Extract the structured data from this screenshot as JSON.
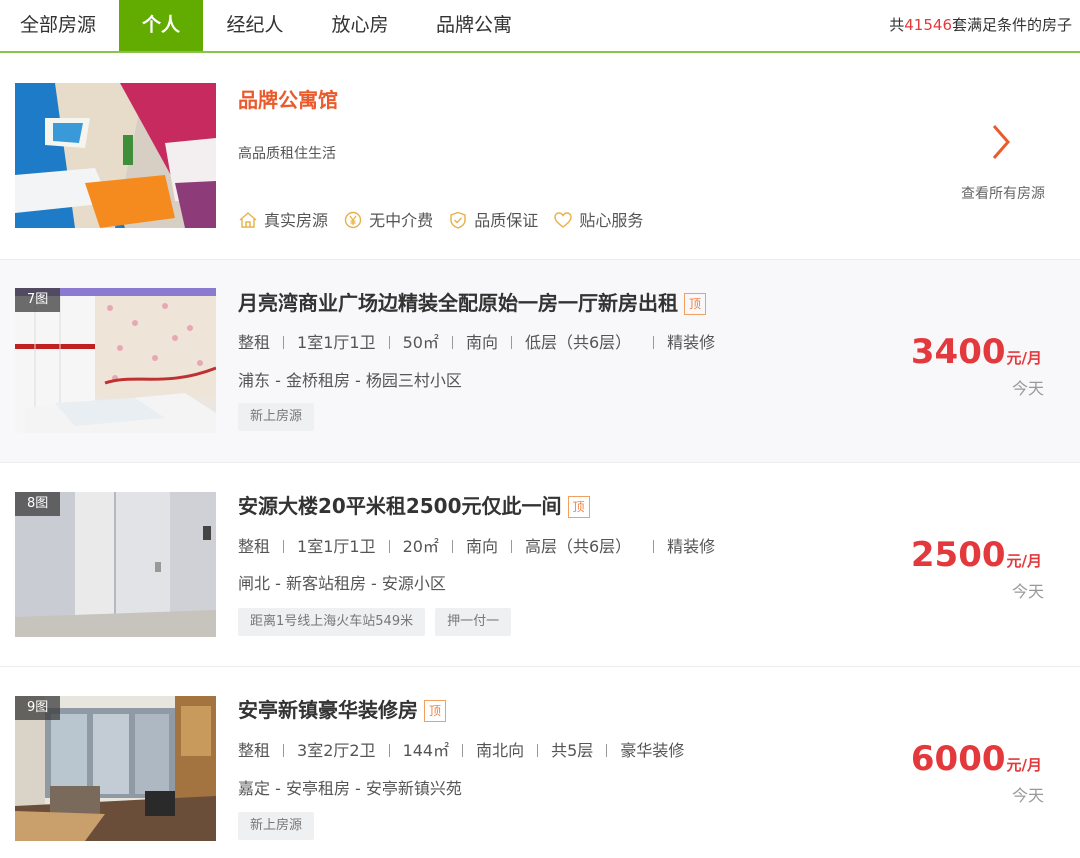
{
  "tabs": [
    {
      "label": "全部房源",
      "active": false
    },
    {
      "label": "个人",
      "active": true
    },
    {
      "label": "经纪人",
      "active": false
    },
    {
      "label": "放心房",
      "active": false
    },
    {
      "label": "品牌公寓",
      "active": false
    }
  ],
  "summary": {
    "prefix": "共",
    "count": "41546",
    "suffix": "套满足条件的房子"
  },
  "brand": {
    "title": "品牌公寓馆",
    "subtitle": "高品质租住生活",
    "features": [
      {
        "icon": "house-icon",
        "label": "真实房源"
      },
      {
        "icon": "yen-icon",
        "label": "无中介费"
      },
      {
        "icon": "shield-check-icon",
        "label": "品质保证"
      },
      {
        "icon": "heart-icon",
        "label": "贴心服务"
      }
    ],
    "view_all": "查看所有房源"
  },
  "listings": [
    {
      "photo_count": "7图",
      "title": "月亮湾商业广场边精装全配原始一房一厅新房出租",
      "top_tag": "顶",
      "info": [
        "整租",
        "1室1厅1卫",
        "50㎡",
        "南向",
        "低层（共6层）",
        "精装修"
      ],
      "location": "浦东 - 金桥租房 - 杨园三村小区",
      "tags": [
        "新上房源"
      ],
      "price": "3400",
      "price_unit": "元/月",
      "date": "今天"
    },
    {
      "photo_count": "8图",
      "title": "安源大楼20平米租2500元仅此一间",
      "top_tag": "顶",
      "info": [
        "整租",
        "1室1厅1卫",
        "20㎡",
        "南向",
        "高层（共6层）",
        "精装修"
      ],
      "location": "闸北 - 新客站租房 - 安源小区",
      "tags": [
        "距离1号线上海火车站549米",
        "押一付一"
      ],
      "price": "2500",
      "price_unit": "元/月",
      "date": "今天"
    },
    {
      "photo_count": "9图",
      "title": "安亭新镇豪华装修房",
      "top_tag": "顶",
      "info": [
        "整租",
        "3室2厅2卫",
        "144㎡",
        "南北向",
        "共5层",
        "豪华装修"
      ],
      "location": "嘉定 - 安亭租房 - 安亭新镇兴苑",
      "tags": [
        "新上房源"
      ],
      "price": "6000",
      "price_unit": "元/月",
      "date": "今天"
    }
  ],
  "colors": {
    "accent_green": "#62ab00",
    "price_red": "#e4393c",
    "brand_orange": "#ea5a2b"
  }
}
